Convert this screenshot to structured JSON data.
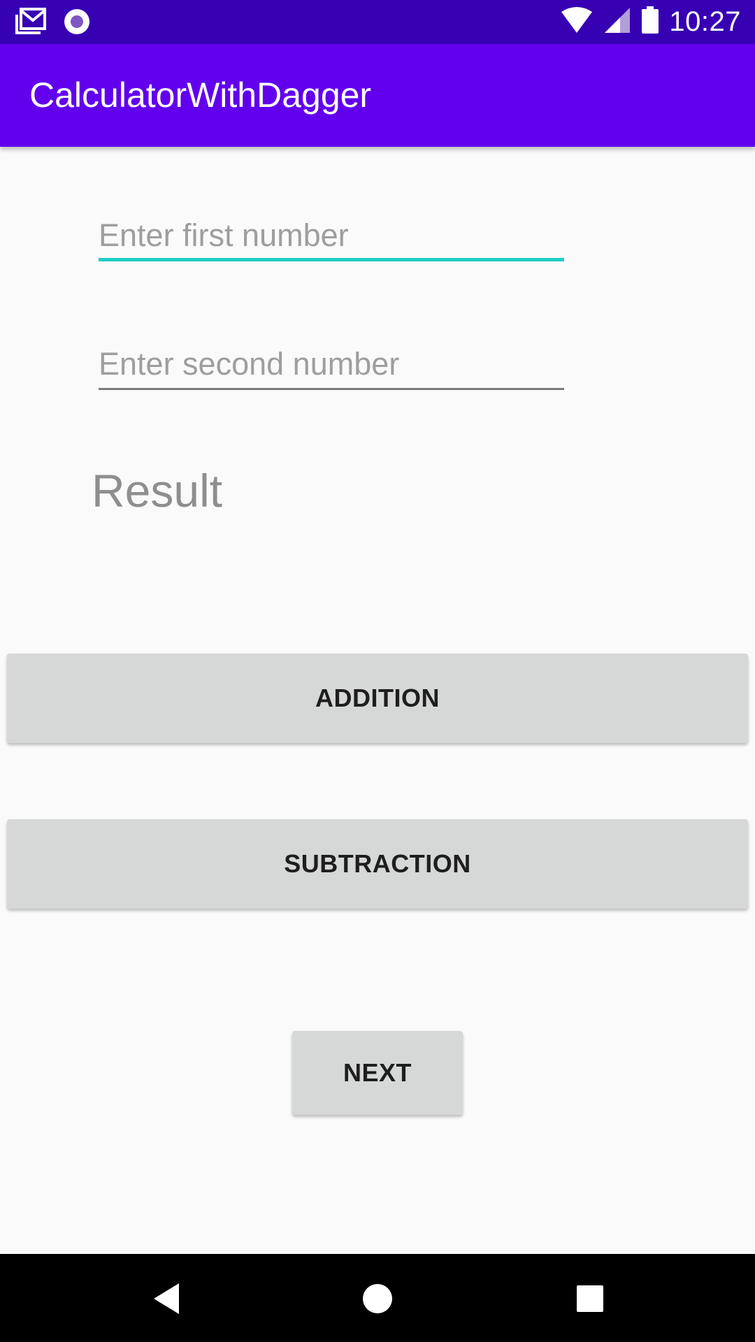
{
  "status_bar": {
    "time": "10:27",
    "icons": [
      "gmail-icon",
      "radio-button-icon",
      "wifi-icon",
      "cell-signal-icon",
      "battery-icon"
    ]
  },
  "app_bar": {
    "title": "CalculatorWithDagger",
    "color": "#6200ee",
    "status_color": "#3700b3"
  },
  "form": {
    "first_number": {
      "placeholder": "Enter first number",
      "value": "",
      "focused": true,
      "accent": "#1dcfc4"
    },
    "second_number": {
      "placeholder": "Enter second number",
      "value": ""
    },
    "result_label": "Result"
  },
  "buttons": {
    "addition": "ADDITION",
    "subtraction": "SUBTRACTION",
    "next": "NEXT"
  },
  "nav_bar": {
    "icons": [
      "back-icon",
      "home-icon",
      "recents-icon"
    ]
  }
}
